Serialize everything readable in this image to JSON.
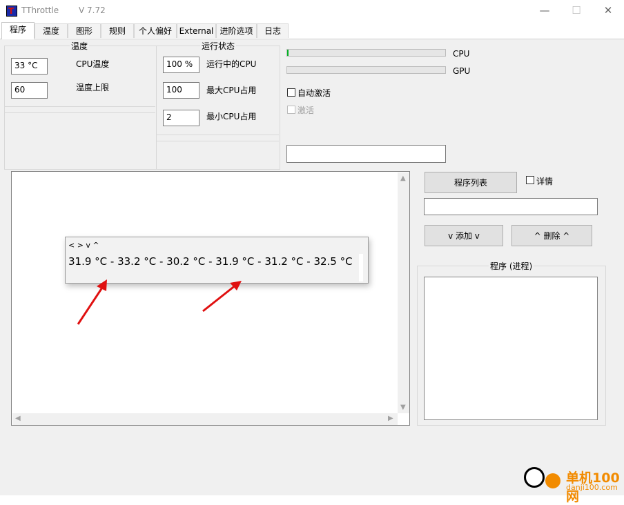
{
  "window": {
    "title": "TThrottle",
    "version": "V 7.72",
    "minimize_glyph": "—",
    "maximize_glyph": "☐",
    "close_glyph": "✕"
  },
  "tabs": [
    {
      "label": "程序",
      "active": true
    },
    {
      "label": "温度",
      "active": false
    },
    {
      "label": "图形",
      "active": false
    },
    {
      "label": "规则",
      "active": false
    },
    {
      "label": "个人偏好",
      "active": false
    },
    {
      "label": "External",
      "active": false
    },
    {
      "label": "进阶选项",
      "active": false
    },
    {
      "label": "日志",
      "active": false
    }
  ],
  "temperature_group": {
    "title": "温度",
    "cpu_temp_value": "33 °C",
    "cpu_temp_label": "CPU温度",
    "temp_limit_value": "60",
    "temp_limit_label": "温度上限"
  },
  "status_group": {
    "title": "运行状态",
    "running_cpu_value": "100 %",
    "running_cpu_label": "运行中的CPU",
    "max_cpu_value": "100",
    "max_cpu_label": "最大CPU占用",
    "min_cpu_value": "2",
    "min_cpu_label": "最小CPU占用"
  },
  "bars": {
    "cpu_label": "CPU",
    "cpu_level": 0.01,
    "gpu_label": "GPU",
    "gpu_level": 0
  },
  "options": {
    "auto_activate_label": "自动激活",
    "activate_label": "激活"
  },
  "popup": {
    "nav": "< > v ^",
    "temperatures": "31.9 °C - 33.2 °C - 30.2 °C - 31.9 °C - 31.2 °C - 32.5 °C"
  },
  "right_panel": {
    "program_list_button": "程序列表",
    "details_label": "详情",
    "add_button": "v 添加 v",
    "delete_button": "^ 删除 ^",
    "process_group_title": "程序 (进程)"
  },
  "watermark": {
    "name": "单机100网",
    "url": "danji100.com"
  },
  "colors": {
    "progress_green": "#06b025",
    "arrow_red": "#e01010",
    "watermark_orange": "#f28b00"
  }
}
